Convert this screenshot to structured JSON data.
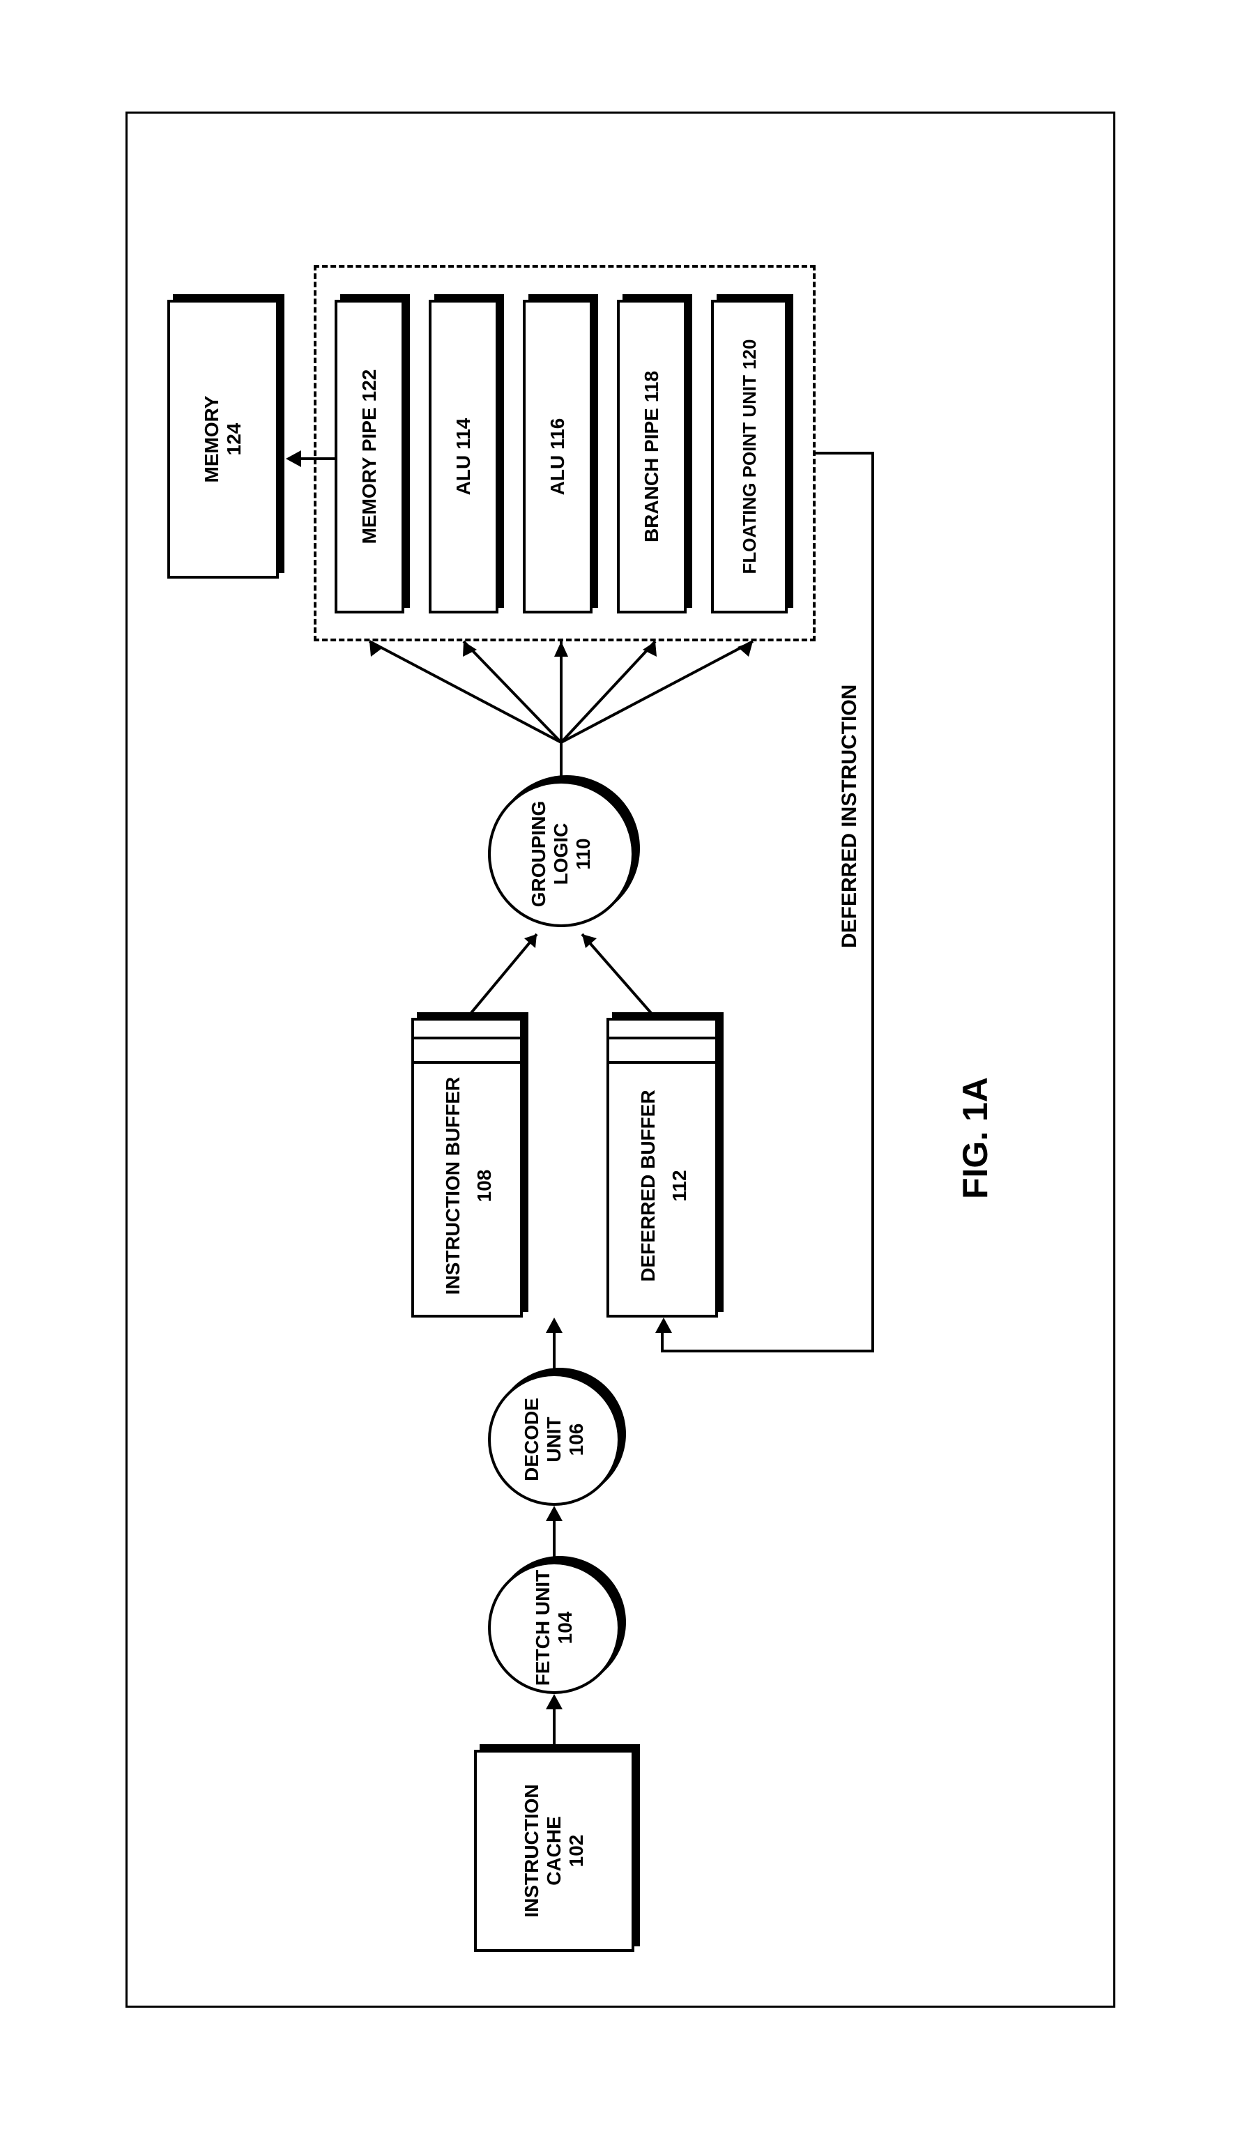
{
  "figure_caption": "FIG. 1A",
  "deferred_label": "DEFERRED INSTRUCTION",
  "blocks": {
    "instruction_cache": {
      "name": "INSTRUCTION CACHE",
      "num": "102"
    },
    "fetch_unit": {
      "name": "FETCH UNIT",
      "num": "104"
    },
    "decode_unit": {
      "name": "DECODE UNIT",
      "num": "106"
    },
    "instruction_buffer": {
      "name": "INSTRUCTION BUFFER",
      "num": "108"
    },
    "deferred_buffer": {
      "name": "DEFERRED BUFFER",
      "num": "112"
    },
    "grouping_logic": {
      "name": "GROUPING LOGIC",
      "num": "110"
    },
    "memory_pipe": {
      "name": "MEMORY PIPE",
      "num": "122"
    },
    "alu_1": {
      "name": "ALU",
      "num": "114"
    },
    "alu_2": {
      "name": "ALU",
      "num": "116"
    },
    "branch_pipe": {
      "name": "BRANCH PIPE",
      "num": "118"
    },
    "fpu": {
      "name": "FLOATING POINT UNIT",
      "num": "120"
    },
    "memory": {
      "name": "MEMORY",
      "num": "124"
    }
  }
}
